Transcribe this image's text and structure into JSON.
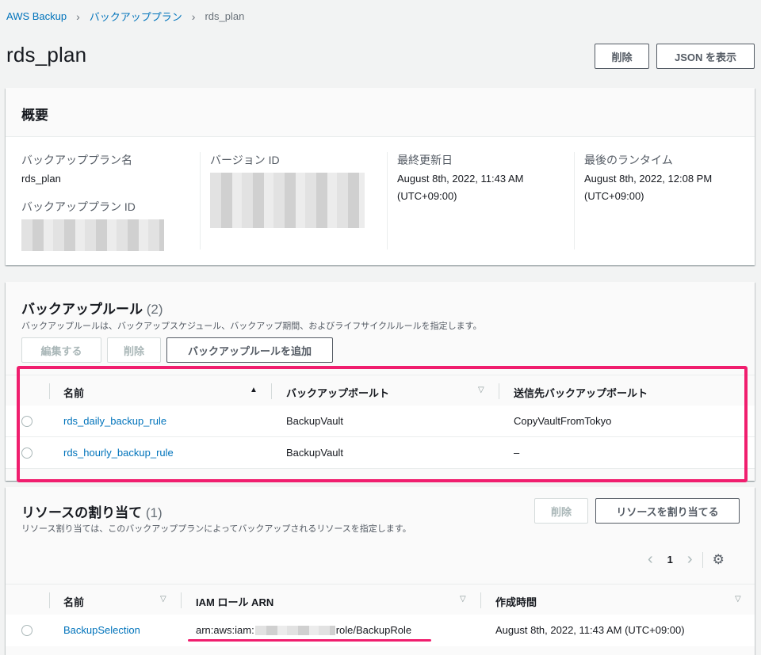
{
  "breadcrumb": {
    "items": [
      "AWS Backup",
      "バックアッププラン"
    ],
    "current": "rds_plan"
  },
  "page": {
    "title": "rds_plan",
    "delete_label": "削除",
    "json_label": "JSON を表示"
  },
  "summary": {
    "title": "概要",
    "plan_name_label": "バックアッププラン名",
    "plan_name": "rds_plan",
    "plan_id_label": "バックアッププラン ID",
    "version_id_label": "バージョン ID",
    "last_updated_label": "最終更新日",
    "last_updated_line1": "August 8th, 2022, 11:43 AM",
    "last_updated_line2": "(UTC+09:00)",
    "last_run_label": "最後のランタイム",
    "last_run_line1": "August 8th, 2022, 12:08 PM",
    "last_run_line2": "(UTC+09:00)"
  },
  "rules": {
    "title": "バックアップルール",
    "count": "(2)",
    "description": "バックアップルールは、バックアップスケジュール、バックアップ期間、およびライフサイクルルールを指定します。",
    "edit_label": "編集する",
    "delete_label": "削除",
    "add_label": "バックアップルールを追加",
    "columns": [
      "名前",
      "バックアップボールト",
      "送信先バックアップボールト"
    ],
    "rows": [
      {
        "name": "rds_daily_backup_rule",
        "vault": "BackupVault",
        "dest": "CopyVaultFromTokyo"
      },
      {
        "name": "rds_hourly_backup_rule",
        "vault": "BackupVault",
        "dest": "–"
      }
    ]
  },
  "resources": {
    "title": "リソースの割り当て",
    "count": "(1)",
    "description": "リソース割り当ては、このバックアッププランによってバックアップされるリソースを指定します。",
    "delete_label": "削除",
    "assign_label": "リソースを割り当てる",
    "page_number": "1",
    "columns": [
      "名前",
      "IAM ロール ARN",
      "作成時間"
    ],
    "rows": [
      {
        "name": "BackupSelection",
        "arn_prefix": "arn:aws:iam:",
        "arn_suffix": "role/BackupRole",
        "created": "August 8th, 2022, 11:43 AM (UTC+09:00)"
      }
    ]
  },
  "colors": {
    "link": "#0073bb",
    "highlight": "#f01e6e"
  }
}
